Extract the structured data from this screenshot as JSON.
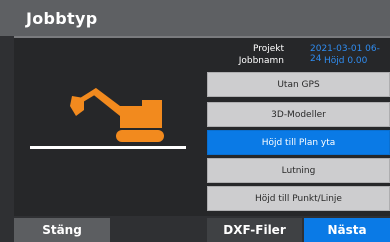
{
  "title": "Jobbtyp",
  "project": {
    "label": "Projekt",
    "value": "2021-03-01 06-24"
  },
  "job_name": {
    "label": "Jobbnamn",
    "value": "Höjd 0.00"
  },
  "menu": [
    {
      "label": "Utan GPS",
      "active": false
    },
    {
      "label": "3D-Modeller",
      "active": false
    },
    {
      "label": "Höjd till Plan yta",
      "active": true
    },
    {
      "label": "Lutning",
      "active": false
    },
    {
      "label": "Höjd till Punkt/Linje",
      "active": false
    }
  ],
  "buttons": {
    "close": "Stäng",
    "dxf": "DXF-Filer",
    "next": "Nästa"
  },
  "colors": {
    "accent": "#0a7ae6",
    "excavator": "#f28a1e",
    "background": "#2f3033"
  },
  "icons": {
    "excavator": "excavator-icon"
  }
}
